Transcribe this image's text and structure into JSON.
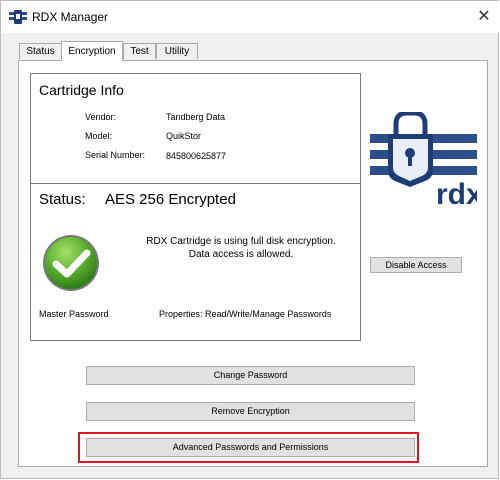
{
  "window": {
    "title": "RDX Manager",
    "close_symbol": "✕"
  },
  "tabs": [
    {
      "label": "Status"
    },
    {
      "label": "Encryption"
    },
    {
      "label": "Test"
    },
    {
      "label": "Utility"
    }
  ],
  "cartridge": {
    "heading": "Cartridge Info",
    "vendor_label": "Vendor:",
    "vendor_value": "Tandberg Data",
    "model_label": "Model:",
    "model_value": "QuikStor",
    "serial_label": "Serial Number:",
    "serial_value": "845800625877"
  },
  "status": {
    "label": "Status:",
    "value": "AES 256 Encrypted",
    "message_line1": "RDX Cartridge is using full disk encryption.",
    "message_line2": "Data access is allowed.",
    "master_password": "Master Password",
    "properties": "Properties: Read/Write/Manage Passwords"
  },
  "buttons": {
    "disable_access": "Disable Access",
    "change_password": "Change Password",
    "remove_encryption": "Remove Encryption",
    "advanced_passwords": "Advanced Passwords and Permissions"
  },
  "logo": {
    "text": "rdx"
  },
  "colors": {
    "highlight": "#e3161b",
    "logo_blue": "#2c4f8c",
    "check_green": "#5cb030"
  }
}
